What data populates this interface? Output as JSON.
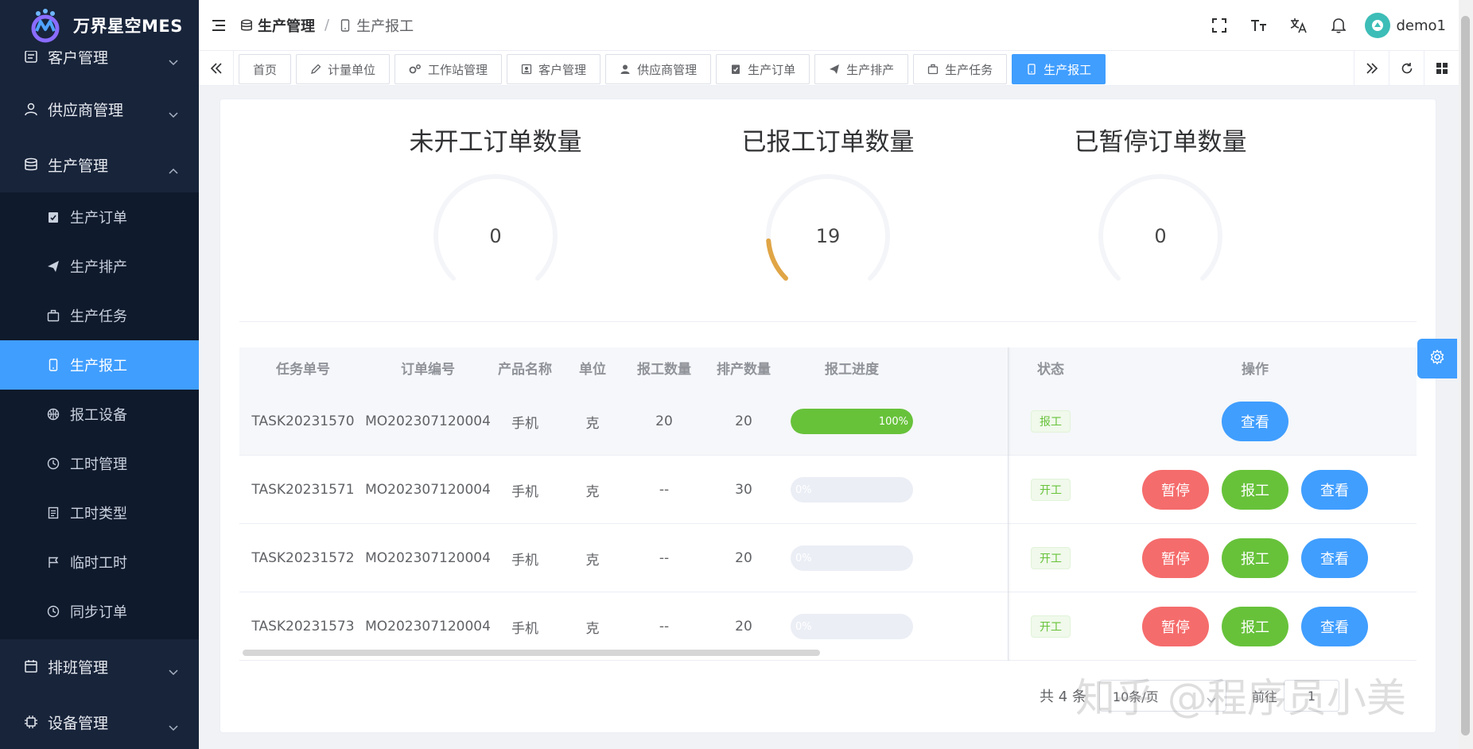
{
  "app": {
    "title": "万界星空MES",
    "colors": {
      "sidebar_bg": "#18243a",
      "submenu_bg": "#0f1a2c",
      "accent": "#409eff",
      "success": "#67c23a",
      "danger": "#f56c6c",
      "warning": "#e6a23c"
    }
  },
  "sidebar": {
    "top_items": [
      {
        "label": "客户管理",
        "icon": "customer-icon"
      },
      {
        "label": "供应商管理",
        "icon": "user-icon"
      },
      {
        "label": "生产管理",
        "icon": "database-icon"
      }
    ],
    "sub_items": [
      {
        "label": "生产订单",
        "icon": "clipboard-check-icon"
      },
      {
        "label": "生产排产",
        "icon": "paper-plane-icon"
      },
      {
        "label": "生产任务",
        "icon": "briefcase-icon"
      },
      {
        "label": "生产报工",
        "icon": "mobile-icon",
        "active": true
      },
      {
        "label": "报工设备",
        "icon": "basketball-icon"
      },
      {
        "label": "工时管理",
        "icon": "clock-icon"
      },
      {
        "label": "工时类型",
        "icon": "document-icon"
      },
      {
        "label": "临时工时",
        "icon": "flag-icon"
      },
      {
        "label": "同步订单",
        "icon": "clock-icon"
      }
    ],
    "bottom_items": [
      {
        "label": "排班管理",
        "icon": "calendar-icon"
      },
      {
        "label": "设备管理",
        "icon": "cpu-icon"
      }
    ]
  },
  "header": {
    "breadcrumb": [
      {
        "label": "生产管理",
        "icon": "database-icon"
      },
      {
        "label": "生产报工",
        "icon": "mobile-icon"
      }
    ],
    "separator": "/",
    "username": "demo1"
  },
  "tags": [
    {
      "label": "首页",
      "icon": ""
    },
    {
      "label": "计量单位",
      "icon": "edit-icon"
    },
    {
      "label": "工作站管理",
      "icon": "gears-icon"
    },
    {
      "label": "客户管理",
      "icon": "id-card-icon"
    },
    {
      "label": "供应商管理",
      "icon": "user-icon"
    },
    {
      "label": "生产订单",
      "icon": "clipboard-check-icon"
    },
    {
      "label": "生产排产",
      "icon": "paper-plane-icon"
    },
    {
      "label": "生产任务",
      "icon": "briefcase-icon"
    },
    {
      "label": "生产报工",
      "icon": "mobile-icon",
      "active": true
    }
  ],
  "gauges": [
    {
      "title": "未开工订单数量",
      "value": "0",
      "fraction": 0
    },
    {
      "title": "已报工订单数量",
      "value": "19",
      "fraction": 0.15
    },
    {
      "title": "已暂停订单数量",
      "value": "0",
      "fraction": 0
    }
  ],
  "table": {
    "columns": [
      "任务单号",
      "订单编号",
      "产品名称",
      "单位",
      "报工数量",
      "排产数量",
      "报工进度",
      "状态",
      "操作"
    ],
    "rows": [
      {
        "task": "TASK20231570",
        "order": "MO202307120004",
        "product": "手机",
        "unit": "克",
        "reported": "20",
        "scheduled": "20",
        "progress": "100%",
        "progress_value": 1.0,
        "status": "报工",
        "actions": [
          "查看"
        ]
      },
      {
        "task": "TASK20231571",
        "order": "MO202307120004",
        "product": "手机",
        "unit": "克",
        "reported": "--",
        "scheduled": "30",
        "progress": "0%",
        "progress_value": 0,
        "status": "开工",
        "actions": [
          "暂停",
          "报工",
          "查看"
        ]
      },
      {
        "task": "TASK20231572",
        "order": "MO202307120004",
        "product": "手机",
        "unit": "克",
        "reported": "--",
        "scheduled": "20",
        "progress": "0%",
        "progress_value": 0,
        "status": "开工",
        "actions": [
          "暂停",
          "报工",
          "查看"
        ]
      },
      {
        "task": "TASK20231573",
        "order": "MO202307120004",
        "product": "手机",
        "unit": "克",
        "reported": "--",
        "scheduled": "20",
        "progress": "0%",
        "progress_value": 0,
        "status": "开工",
        "actions": [
          "暂停",
          "报工",
          "查看"
        ]
      }
    ]
  },
  "pagination": {
    "total": "共 4 条",
    "page_size": "10条/页",
    "goto_label": "前往",
    "page": "1"
  },
  "watermark": "知乎 @程序员小美"
}
